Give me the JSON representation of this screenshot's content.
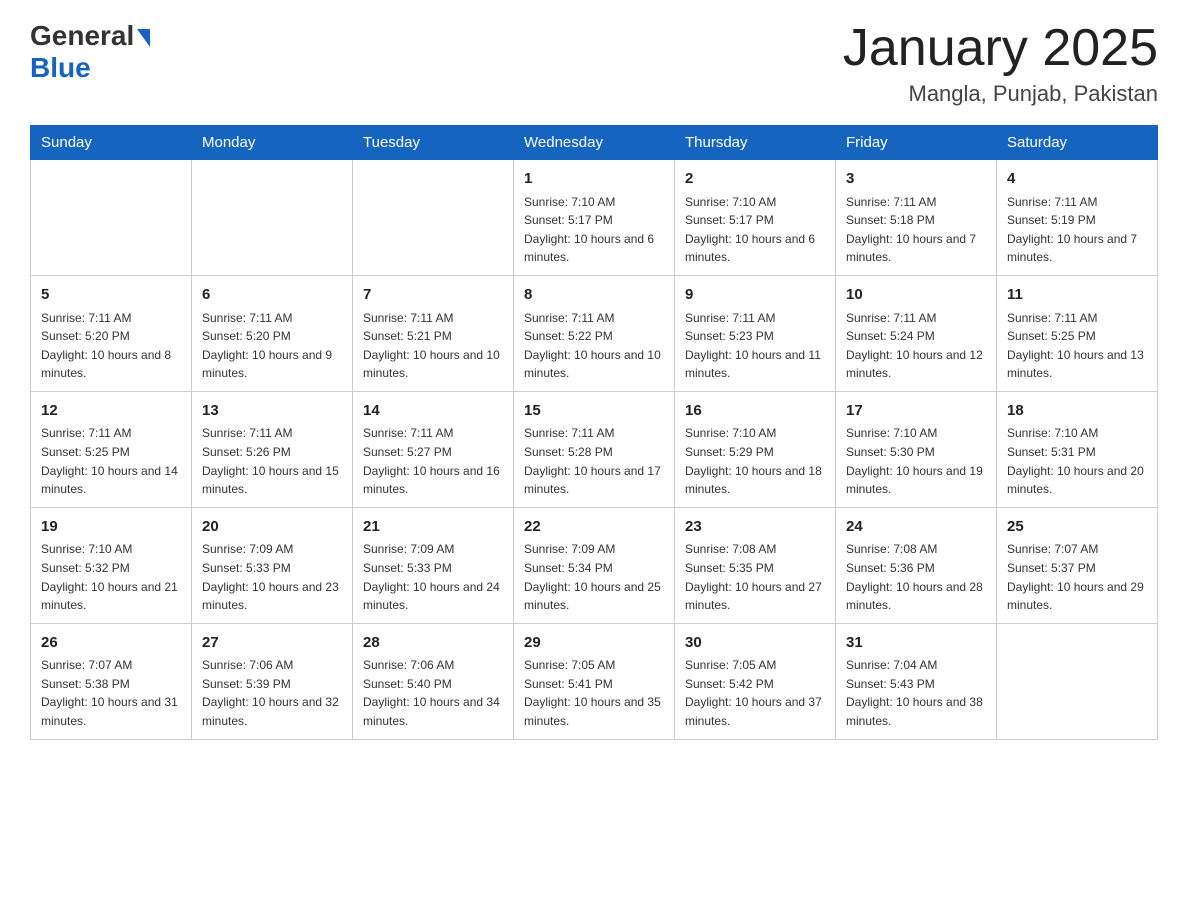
{
  "header": {
    "logo_general": "General",
    "logo_blue": "Blue",
    "title": "January 2025",
    "subtitle": "Mangla, Punjab, Pakistan"
  },
  "days_of_week": [
    "Sunday",
    "Monday",
    "Tuesday",
    "Wednesday",
    "Thursday",
    "Friday",
    "Saturday"
  ],
  "weeks": [
    [
      {
        "day": "",
        "info": ""
      },
      {
        "day": "",
        "info": ""
      },
      {
        "day": "",
        "info": ""
      },
      {
        "day": "1",
        "info": "Sunrise: 7:10 AM\nSunset: 5:17 PM\nDaylight: 10 hours and 6 minutes."
      },
      {
        "day": "2",
        "info": "Sunrise: 7:10 AM\nSunset: 5:17 PM\nDaylight: 10 hours and 6 minutes."
      },
      {
        "day": "3",
        "info": "Sunrise: 7:11 AM\nSunset: 5:18 PM\nDaylight: 10 hours and 7 minutes."
      },
      {
        "day": "4",
        "info": "Sunrise: 7:11 AM\nSunset: 5:19 PM\nDaylight: 10 hours and 7 minutes."
      }
    ],
    [
      {
        "day": "5",
        "info": "Sunrise: 7:11 AM\nSunset: 5:20 PM\nDaylight: 10 hours and 8 minutes."
      },
      {
        "day": "6",
        "info": "Sunrise: 7:11 AM\nSunset: 5:20 PM\nDaylight: 10 hours and 9 minutes."
      },
      {
        "day": "7",
        "info": "Sunrise: 7:11 AM\nSunset: 5:21 PM\nDaylight: 10 hours and 10 minutes."
      },
      {
        "day": "8",
        "info": "Sunrise: 7:11 AM\nSunset: 5:22 PM\nDaylight: 10 hours and 10 minutes."
      },
      {
        "day": "9",
        "info": "Sunrise: 7:11 AM\nSunset: 5:23 PM\nDaylight: 10 hours and 11 minutes."
      },
      {
        "day": "10",
        "info": "Sunrise: 7:11 AM\nSunset: 5:24 PM\nDaylight: 10 hours and 12 minutes."
      },
      {
        "day": "11",
        "info": "Sunrise: 7:11 AM\nSunset: 5:25 PM\nDaylight: 10 hours and 13 minutes."
      }
    ],
    [
      {
        "day": "12",
        "info": "Sunrise: 7:11 AM\nSunset: 5:25 PM\nDaylight: 10 hours and 14 minutes."
      },
      {
        "day": "13",
        "info": "Sunrise: 7:11 AM\nSunset: 5:26 PM\nDaylight: 10 hours and 15 minutes."
      },
      {
        "day": "14",
        "info": "Sunrise: 7:11 AM\nSunset: 5:27 PM\nDaylight: 10 hours and 16 minutes."
      },
      {
        "day": "15",
        "info": "Sunrise: 7:11 AM\nSunset: 5:28 PM\nDaylight: 10 hours and 17 minutes."
      },
      {
        "day": "16",
        "info": "Sunrise: 7:10 AM\nSunset: 5:29 PM\nDaylight: 10 hours and 18 minutes."
      },
      {
        "day": "17",
        "info": "Sunrise: 7:10 AM\nSunset: 5:30 PM\nDaylight: 10 hours and 19 minutes."
      },
      {
        "day": "18",
        "info": "Sunrise: 7:10 AM\nSunset: 5:31 PM\nDaylight: 10 hours and 20 minutes."
      }
    ],
    [
      {
        "day": "19",
        "info": "Sunrise: 7:10 AM\nSunset: 5:32 PM\nDaylight: 10 hours and 21 minutes."
      },
      {
        "day": "20",
        "info": "Sunrise: 7:09 AM\nSunset: 5:33 PM\nDaylight: 10 hours and 23 minutes."
      },
      {
        "day": "21",
        "info": "Sunrise: 7:09 AM\nSunset: 5:33 PM\nDaylight: 10 hours and 24 minutes."
      },
      {
        "day": "22",
        "info": "Sunrise: 7:09 AM\nSunset: 5:34 PM\nDaylight: 10 hours and 25 minutes."
      },
      {
        "day": "23",
        "info": "Sunrise: 7:08 AM\nSunset: 5:35 PM\nDaylight: 10 hours and 27 minutes."
      },
      {
        "day": "24",
        "info": "Sunrise: 7:08 AM\nSunset: 5:36 PM\nDaylight: 10 hours and 28 minutes."
      },
      {
        "day": "25",
        "info": "Sunrise: 7:07 AM\nSunset: 5:37 PM\nDaylight: 10 hours and 29 minutes."
      }
    ],
    [
      {
        "day": "26",
        "info": "Sunrise: 7:07 AM\nSunset: 5:38 PM\nDaylight: 10 hours and 31 minutes."
      },
      {
        "day": "27",
        "info": "Sunrise: 7:06 AM\nSunset: 5:39 PM\nDaylight: 10 hours and 32 minutes."
      },
      {
        "day": "28",
        "info": "Sunrise: 7:06 AM\nSunset: 5:40 PM\nDaylight: 10 hours and 34 minutes."
      },
      {
        "day": "29",
        "info": "Sunrise: 7:05 AM\nSunset: 5:41 PM\nDaylight: 10 hours and 35 minutes."
      },
      {
        "day": "30",
        "info": "Sunrise: 7:05 AM\nSunset: 5:42 PM\nDaylight: 10 hours and 37 minutes."
      },
      {
        "day": "31",
        "info": "Sunrise: 7:04 AM\nSunset: 5:43 PM\nDaylight: 10 hours and 38 minutes."
      },
      {
        "day": "",
        "info": ""
      }
    ]
  ]
}
